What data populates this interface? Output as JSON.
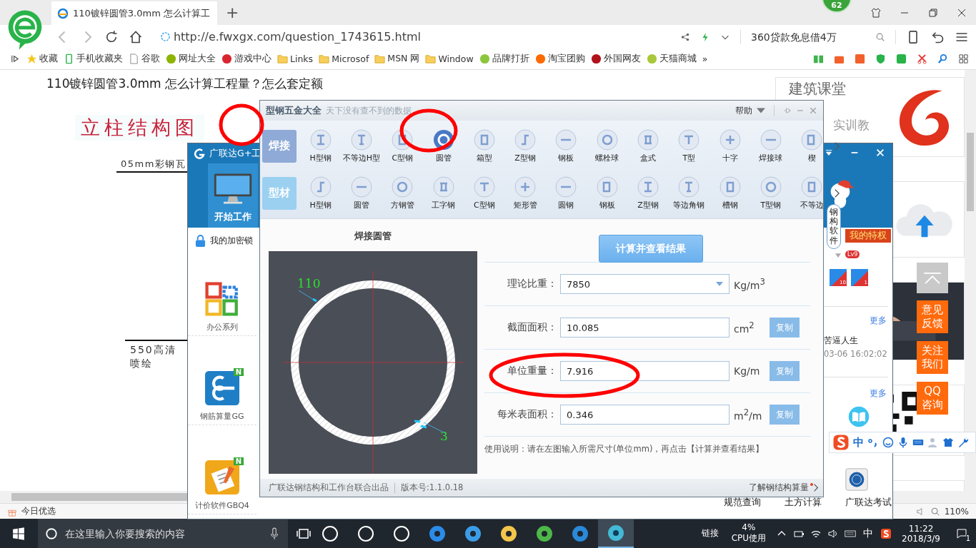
{
  "browser": {
    "tab": {
      "title": "110镀锌圆管3.0mm 怎么计算工"
    },
    "new_tab": "+",
    "badge": "62",
    "address": {
      "value": "http://e.fwxgx.com/question_1743615.html"
    },
    "search": {
      "placeholder": "360贷款免息借4万"
    },
    "bookmarks": [
      {
        "label": "收藏",
        "kind": "star"
      },
      {
        "label": "手机收藏夹",
        "kind": "phone"
      },
      {
        "label": "谷歌",
        "kind": "page"
      },
      {
        "label": "网址大全",
        "kind": "site",
        "color": "#8cb400"
      },
      {
        "label": "游戏中心",
        "kind": "site",
        "color": "#d8262f"
      },
      {
        "label": "Links",
        "kind": "folder"
      },
      {
        "label": "Microsof",
        "kind": "folder"
      },
      {
        "label": "MSN 网",
        "kind": "folder"
      },
      {
        "label": "Window",
        "kind": "folder"
      },
      {
        "label": "品牌打折",
        "kind": "site",
        "color": "#8cc63f"
      },
      {
        "label": "淘宝团购",
        "kind": "site",
        "color": "#ff6a00"
      },
      {
        "label": "外国网友",
        "kind": "site",
        "color": "#b0121b"
      },
      {
        "label": "天猫商城",
        "kind": "site",
        "color": "#a8c83a"
      }
    ],
    "more": "»"
  },
  "article": {
    "title": "110镀锌圆管3.0mm  怎么计算工程量？怎么套定额",
    "figure": {
      "heading": "立柱结构图",
      "top_label": "05mm彩钢瓦",
      "bottom_label": "550高清喷绘"
    }
  },
  "sidebar": {
    "course_card": {
      "title": "建筑课堂",
      "subtitle": "实训教"
    },
    "float_buttons": [
      {
        "label": "意见反馈"
      },
      {
        "label": "关注我们"
      },
      {
        "label": "QQ咨询"
      }
    ]
  },
  "gld_window": {
    "title": "广联达G+工",
    "nav": [
      {
        "label": "开始工作",
        "selected": true
      }
    ],
    "lock": "我的加密锁",
    "apps": [
      {
        "label": "办公系列"
      },
      {
        "label": "钢筋算量GG",
        "badge": "N"
      },
      {
        "label": "计价软件GBQ4",
        "badge": "N"
      }
    ],
    "mascot_text": "钢构软件",
    "privilege": "我的特权",
    "level": "Lv9",
    "app_badges": [
      {
        "count": "10"
      },
      {
        "count": "1"
      }
    ],
    "news_more": "更多",
    "news_title": "苦逼人生",
    "news_time": "03-06 16:02:02",
    "tools_more": "更多",
    "tools": [
      {
        "label": "规范查询"
      },
      {
        "label": "土方计算"
      },
      {
        "label": "广联达考试"
      }
    ]
  },
  "calc_window": {
    "title": "型钢五金大全",
    "subtitle": "天下没有查不到的数据",
    "help": "帮助",
    "categories": [
      {
        "label": "焊接",
        "selected": true,
        "items": [
          {
            "label": "H型钢",
            "selected": false
          },
          {
            "label": "不等边H型",
            "selected": false
          },
          {
            "label": "C型钢",
            "selected": false
          },
          {
            "label": "圆管",
            "selected": true
          },
          {
            "label": "箱型",
            "selected": false
          },
          {
            "label": "Z型钢",
            "selected": false
          },
          {
            "label": "钢板",
            "selected": false
          },
          {
            "label": "螺栓球",
            "selected": false
          },
          {
            "label": "盒式",
            "selected": false
          },
          {
            "label": "T型",
            "selected": false
          },
          {
            "label": "十字",
            "selected": false
          },
          {
            "label": "焊接球",
            "selected": false
          },
          {
            "label": "楔",
            "selected": false
          }
        ]
      },
      {
        "label": "型材",
        "selected": false,
        "items": [
          {
            "label": "H型钢",
            "selected": false
          },
          {
            "label": "圆管",
            "selected": false
          },
          {
            "label": "方钢管",
            "selected": false
          },
          {
            "label": "工字钢",
            "selected": false
          },
          {
            "label": "C型钢",
            "selected": false
          },
          {
            "label": "矩形管",
            "selected": false
          },
          {
            "label": "圆钢",
            "selected": false
          },
          {
            "label": "钢板",
            "selected": false
          },
          {
            "label": "Z型钢",
            "selected": false
          },
          {
            "label": "等边角钢",
            "selected": false
          },
          {
            "label": "槽钢",
            "selected": false
          },
          {
            "label": "T型钢",
            "selected": false
          },
          {
            "label": "不等边",
            "selected": false
          }
        ]
      }
    ],
    "preview": {
      "title": "焊接圆管",
      "diameter": "110",
      "thickness": "3"
    },
    "calculate": "计算并查看结果",
    "fields": [
      {
        "kind": "select",
        "label": "理论比重：",
        "value": "7850",
        "unit": "Kg/m$^{3}$"
      },
      {
        "kind": "output",
        "label": "截面面积：",
        "value": "10.085",
        "unit": "cm$^{2}$",
        "action": "复制"
      },
      {
        "kind": "output",
        "label": "单位重量：",
        "value": "7.916",
        "unit": "Kg/m",
        "action": "复制"
      },
      {
        "kind": "output",
        "label": "每米表面积：",
        "value": "0.346",
        "unit": "m$^{2}$/m",
        "action": "复制"
      }
    ],
    "instructions": "使用说明：请在左图输入所需尺寸(单位mm)，再点击【计算并查看结果】",
    "footer": {
      "credit": "广联达钢结构和工作台联合出品",
      "version": "版本号:1.1.0.18",
      "link": "了解钢结构算量"
    }
  },
  "ime_bar": {
    "mode": "中"
  },
  "status_bar": {
    "promo": "今日优选",
    "zoom": "110%"
  },
  "taskbar": {
    "search": {
      "placeholder": "在这里输入你要搜索的内容"
    },
    "apps": [
      {
        "selected": false
      },
      {
        "selected": false
      },
      {
        "selected": false
      },
      {
        "selected": false
      },
      {
        "selected": false
      },
      {
        "selected": false
      },
      {
        "selected": false
      },
      {
        "selected": false
      },
      {
        "selected": true
      }
    ],
    "links": "链接",
    "cpu": {
      "value": "4%",
      "label": "CPU使用"
    },
    "ime": "中",
    "time": "11:22",
    "date": "2018/3/9",
    "notifications": "1"
  }
}
